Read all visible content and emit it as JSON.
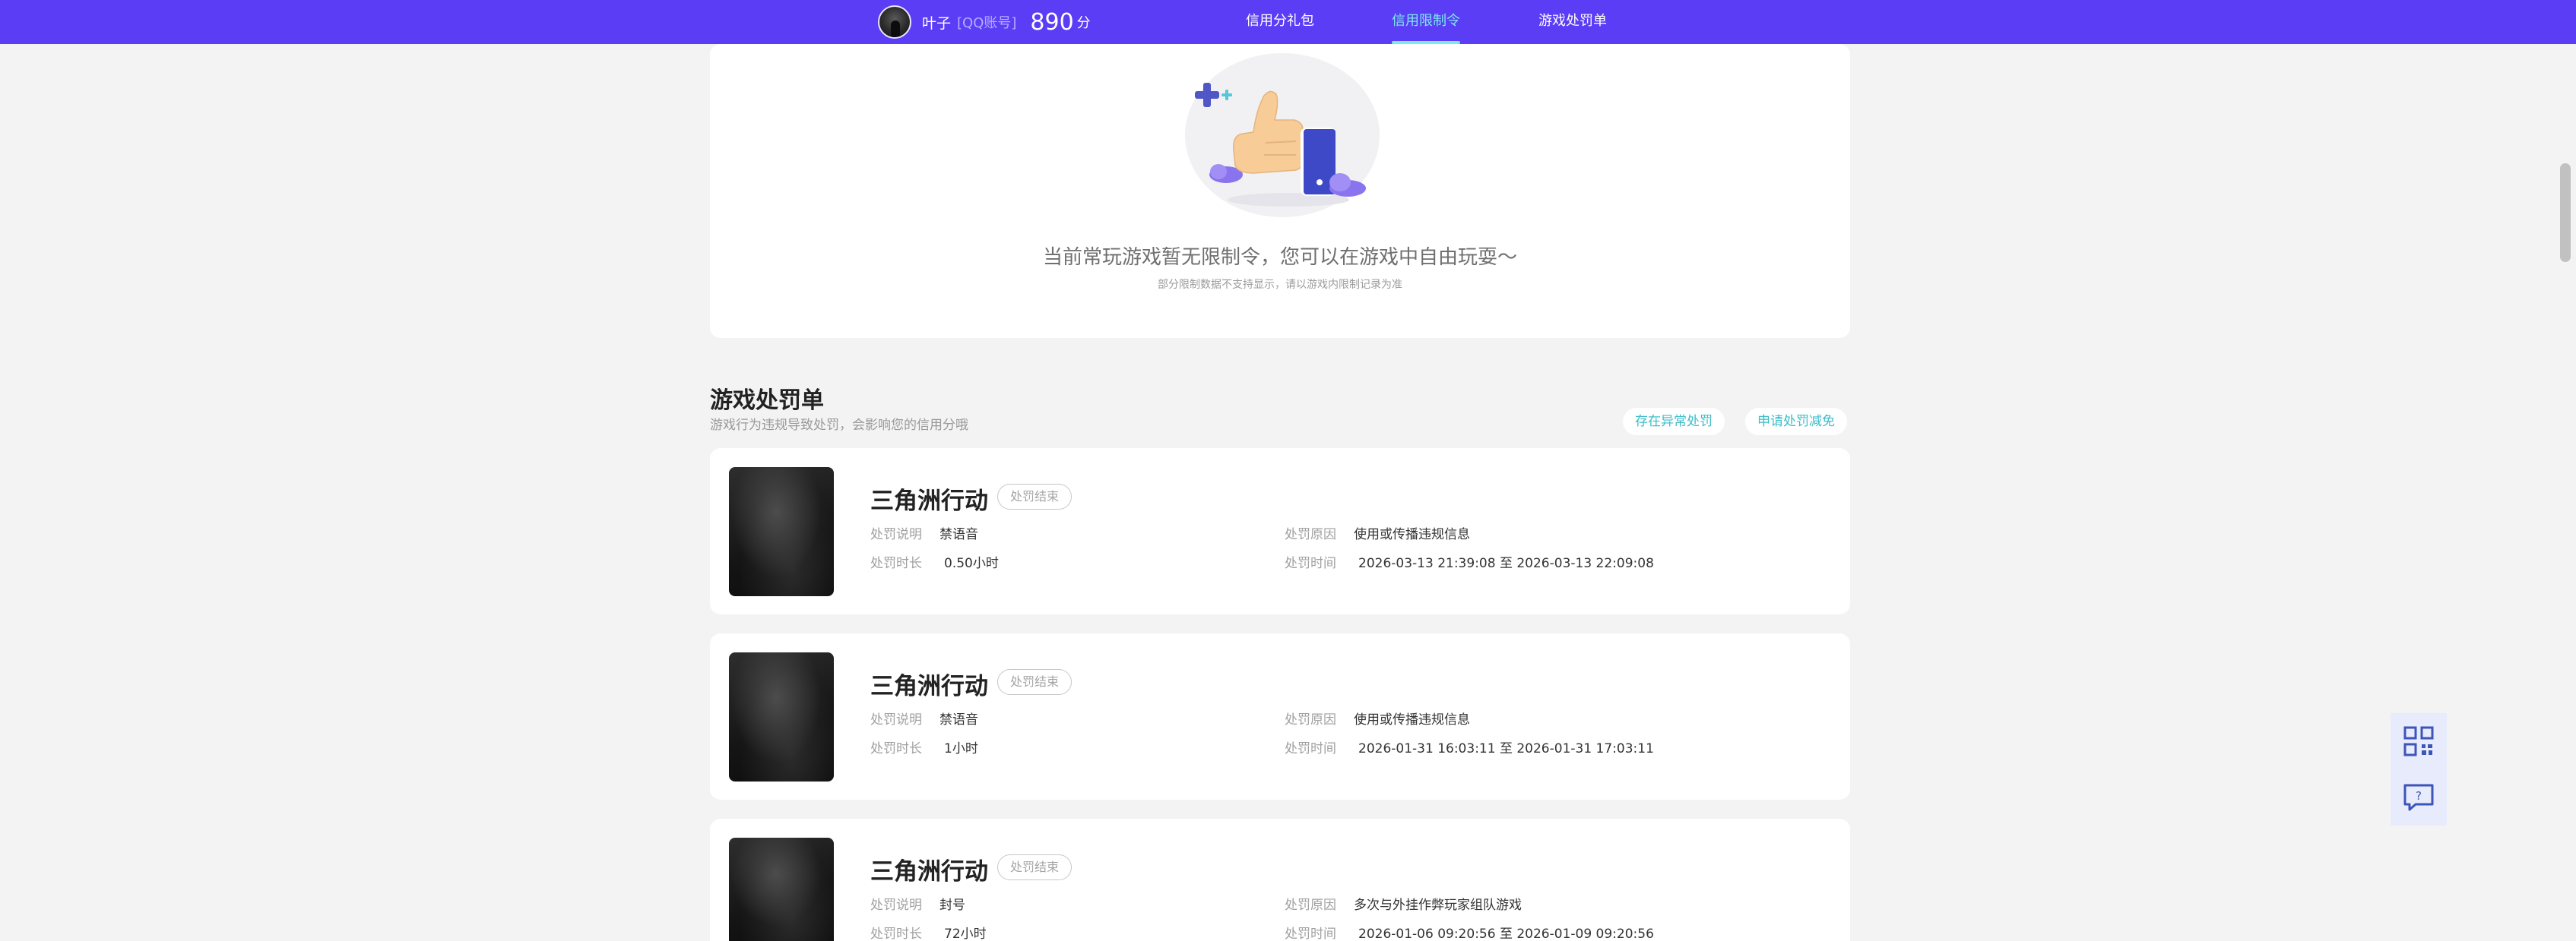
{
  "header": {
    "user": {
      "name": "叶子",
      "account": "[QQ账号]",
      "score": "890",
      "score_unit": "分"
    },
    "nav": [
      {
        "label": "信用分礼包",
        "active": false
      },
      {
        "label": "信用限制令",
        "active": true
      },
      {
        "label": "游戏处罚单",
        "active": false
      }
    ]
  },
  "restriction": {
    "empty_title": "当前常玩游戏暂无限制令，您可以在游戏中自由玩耍～",
    "empty_subtitle": "部分限制数据不支持显示，请以游戏内限制记录为准"
  },
  "penalties": {
    "title": "游戏处罚单",
    "subtitle": "游戏行为违规导致处罚，会影响您的信用分哦",
    "actions": [
      "存在异常处罚",
      "申请处罚减免"
    ],
    "field_labels": {
      "description": "处罚说明",
      "duration": "处罚时长",
      "reason": "处罚原因",
      "time": "处罚时间"
    },
    "items": [
      {
        "game": "三角洲行动",
        "status": "处罚结束",
        "description": "禁语音",
        "duration": "0.50小时",
        "reason": "使用或传播违规信息",
        "time": "2026-03-13 21:39:08 至 2026-03-13 22:09:08"
      },
      {
        "game": "三角洲行动",
        "status": "处罚结束",
        "description": "禁语音",
        "duration": "1小时",
        "reason": "使用或传播违规信息",
        "time": "2026-01-31 16:03:11 至 2026-01-31 17:03:11"
      },
      {
        "game": "三角洲行动",
        "status": "处罚结束",
        "description": "封号",
        "duration": "72小时",
        "reason": "多次与外挂作弊玩家组队游戏",
        "time": "2026-01-06 09:20:56 至 2026-01-09 09:20:56"
      }
    ]
  },
  "side_tools": [
    {
      "icon": "qr-code-icon"
    },
    {
      "icon": "feedback-icon"
    }
  ],
  "colors": {
    "topbar": "#5a3df5",
    "active_nav": "#7ce8ef",
    "accent_teal": "#3cbcc8",
    "page_bg": "#f3f3f4"
  }
}
